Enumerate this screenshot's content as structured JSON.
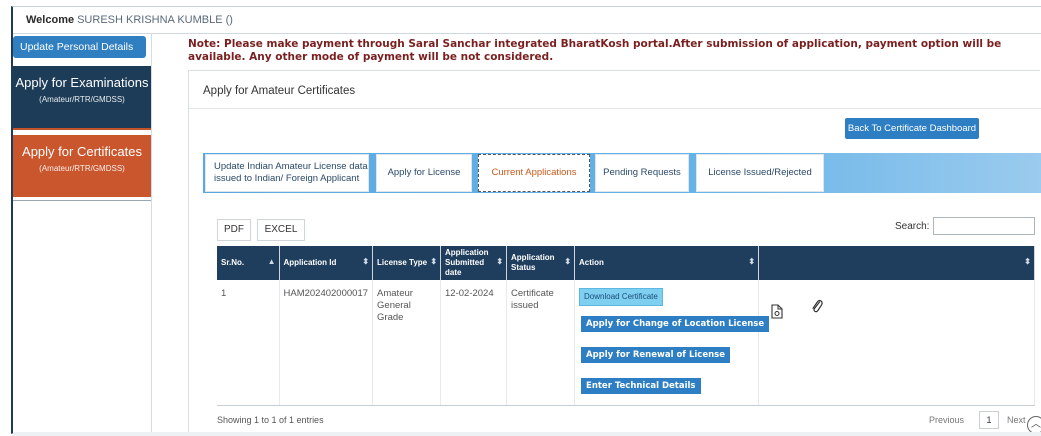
{
  "welcome": {
    "label": "Welcome",
    "name": "SURESH KRISHNA KUMBLE ()"
  },
  "sidebar": {
    "update_button": "Update Personal Details",
    "update_icon": "external-edit-icon",
    "exam": {
      "title": "Apply for Examinations",
      "subtitle": "(Amateur/RTR/GMDSS)"
    },
    "cert": {
      "title": "Apply for Certificates",
      "subtitle": "(Amateur/RTR/GMDSS)"
    }
  },
  "note": "Note: Please make payment through Saral Sanchar integrated BharatKosh portal.After submission of application, payment option will be available. Any other mode of payment will be not considered.",
  "panel": {
    "title": "Apply for Amateur Certificates",
    "back_button": "Back To Certificate Dashboard"
  },
  "tabs": [
    {
      "label": "Update Indian Amateur License data issued to Indian/ Foreign Applicant"
    },
    {
      "label": "Apply for License"
    },
    {
      "label": "Current Applications"
    },
    {
      "label": "Pending Requests"
    },
    {
      "label": "License Issued/Rejected"
    }
  ],
  "toolbar": {
    "pdf": "PDF",
    "excel": "EXCEL",
    "search_label": "Search:",
    "search_value": ""
  },
  "table": {
    "headers": [
      "Sr.No.",
      "Application Id",
      "License Type",
      "Application Submitted date",
      "Application Status",
      "Action",
      ""
    ],
    "rows": [
      {
        "sr": "1",
        "app_id": "HAM202402000017",
        "license_type": "Amateur General Grade",
        "submitted": "12-02-2024",
        "status": "Certificate issued",
        "actions": {
          "download": "Download Certificate",
          "change_location": "Apply for Change of Location License",
          "renewal": "Apply for Renewal of License",
          "technical": "Enter Technical Details"
        }
      }
    ]
  },
  "footer": {
    "showing": "Showing 1 to 1 of 1 entries",
    "previous": "Previous",
    "page": "1",
    "next": "Next"
  },
  "colors": {
    "navy": "#1c3c58",
    "accent_orange": "#c9562d",
    "button_blue": "#2d7ec3",
    "note_red": "#7a1f1f"
  }
}
